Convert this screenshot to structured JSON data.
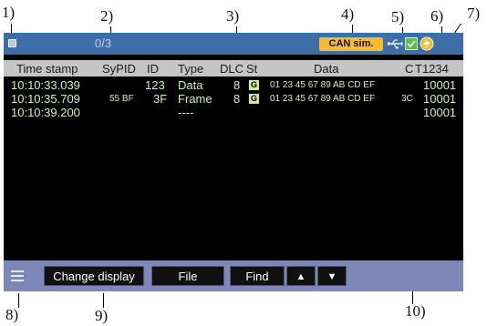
{
  "callouts": [
    "1)",
    "2)",
    "3)",
    "4)",
    "5)",
    "6)",
    "7)",
    "8)",
    "9)",
    "10)"
  ],
  "status_bar": {
    "counter": "0/3",
    "mode_badge": "CAN sim."
  },
  "columns": [
    "Time stamp",
    "SyPID",
    "ID",
    "Type",
    "DLC",
    "St",
    "Data",
    "C",
    "T1234"
  ],
  "rows": [
    {
      "time": "10:10:33.039",
      "sypid": "",
      "id": "123",
      "type": "Data",
      "dlc": "8",
      "st": "G",
      "data": "01 23 45 67 89 AB CD EF",
      "c": "",
      "t": "10001"
    },
    {
      "time": "10:10:35.709",
      "sypid": "55 BF",
      "id": "3F",
      "type": "Frame",
      "dlc": "8",
      "st": "G",
      "data": "01 23 45 67 89 AB CD EF",
      "c": "3C",
      "t": "10001"
    },
    {
      "time": "10:10:39.200",
      "sypid": "",
      "id": "",
      "type": "----",
      "dlc": "",
      "st": "",
      "data": "",
      "c": "",
      "t": "10001"
    }
  ],
  "buttons": {
    "change_display": "Change display",
    "file": "File",
    "find": "Find",
    "up": "▲",
    "down": "▼"
  },
  "icons": [
    "stop-icon",
    "usb-icon",
    "log-icon",
    "power-icon",
    "menu-icon"
  ],
  "colors": {
    "status_bar": "#3e6ea8",
    "badge": "#f2bc33",
    "row_text": "#d4f0b4",
    "header": "#c5c5c5",
    "bottom_bar": "#7d88b8"
  }
}
